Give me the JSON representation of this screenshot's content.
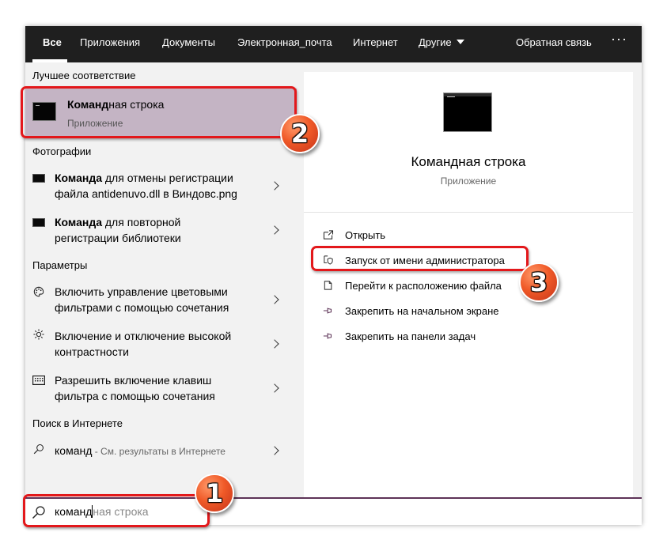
{
  "tabs": [
    {
      "label": "Все",
      "active": true
    },
    {
      "label": "Приложения"
    },
    {
      "label": "Документы"
    },
    {
      "label": "Электронная_почта"
    },
    {
      "label": "Интернет"
    },
    {
      "label": "Другие"
    }
  ],
  "topbar": {
    "feedback_label": "Обратная связь",
    "more_label": "···"
  },
  "sections": {
    "best_match": "Лучшее соответствие",
    "photos": "Фотографии",
    "settings": "Параметры",
    "web": "Поиск в Интернете"
  },
  "best_match": {
    "title_bold": "Команд",
    "title_rest": "ная строка",
    "subtitle": "Приложение"
  },
  "photos": [
    {
      "line1_bold": "Команда",
      "line1_rest": " для отмены регистрации",
      "line2": "файла antidenuvo.dll в Виндовс.png"
    },
    {
      "line1_bold": "Команда",
      "line1_rest": " для повторной",
      "line2": "регистрации библиотеки"
    }
  ],
  "settings": [
    {
      "icon": "palette-icon",
      "line1": "Включить управление цветовыми",
      "line2": "фильтрами с помощью сочетания"
    },
    {
      "icon": "brightness-icon",
      "line1": "Включение и отключение высокой",
      "line2": "контрастности"
    },
    {
      "icon": "keyboard-icon",
      "line1": "Разрешить включение клавиш",
      "line2": "фильтра с помощью сочетания"
    }
  ],
  "web": {
    "query": "команд",
    "hint": " - См. результаты в Интернете"
  },
  "preview": {
    "title": "Командная строка",
    "subtitle": "Приложение",
    "actions": [
      {
        "icon": "open-icon",
        "label": "Открыть"
      },
      {
        "icon": "shield-icon",
        "label": "Запуск от имени администратора"
      },
      {
        "icon": "file-location-icon",
        "label": "Перейти к расположению файла"
      },
      {
        "icon": "pin-icon",
        "label": "Закрепить на начальном экране"
      },
      {
        "icon": "pin-icon",
        "label": "Закрепить на панели задач"
      }
    ]
  },
  "search": {
    "typed": "команд",
    "suggestion": "ная строка"
  },
  "badges": {
    "one": "1",
    "two": "2",
    "three": "3"
  },
  "colors": {
    "topbar": "#1f1f1f",
    "selected_result": "#c4b4c4",
    "search_border": "#5d3357",
    "annotation_red": "#e3181b",
    "badge_orange": "#f05a28"
  }
}
